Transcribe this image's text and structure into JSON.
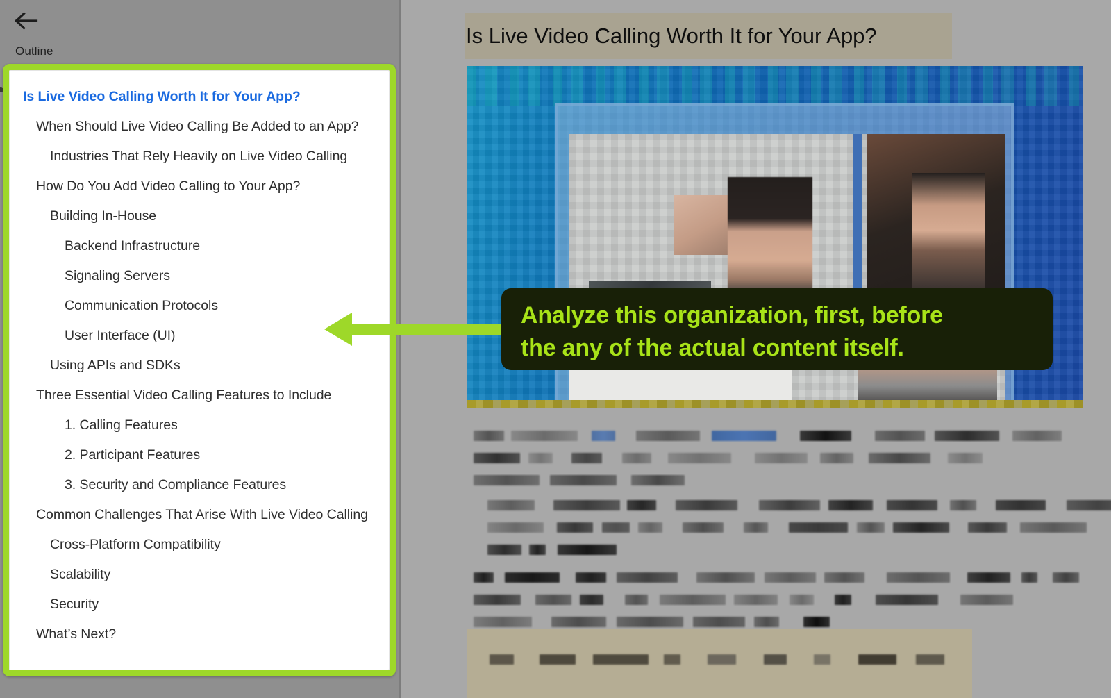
{
  "sidebar": {
    "back_icon": "back-arrow-icon",
    "label": "Outline",
    "outline_items": [
      {
        "text": "Is Live Video Calling Worth It for Your App?",
        "level": 0,
        "current": true
      },
      {
        "text": "When Should Live Video Calling Be Added to an App?",
        "level": 1,
        "current": false
      },
      {
        "text": "Industries That Rely Heavily on Live Video Calling",
        "level": 2,
        "current": false
      },
      {
        "text": "How Do You Add Video Calling to Your App?",
        "level": 1,
        "current": false
      },
      {
        "text": "Building In-House",
        "level": 2,
        "current": false
      },
      {
        "text": "Backend Infrastructure",
        "level": 3,
        "current": false
      },
      {
        "text": "Signaling Servers",
        "level": 3,
        "current": false
      },
      {
        "text": "Communication Protocols",
        "level": 3,
        "current": false
      },
      {
        "text": "User Interface (UI)",
        "level": 3,
        "current": false
      },
      {
        "text": "Using APIs and SDKs",
        "level": 2,
        "current": false
      },
      {
        "text": "Three Essential Video Calling Features to Include",
        "level": 1,
        "current": false
      },
      {
        "text": "1. Calling Features",
        "level": 3,
        "current": false
      },
      {
        "text": "2. Participant Features",
        "level": 3,
        "current": false
      },
      {
        "text": "3. Security and Compliance Features",
        "level": 3,
        "current": false
      },
      {
        "text": "Common Challenges That Arise With Live Video Calling",
        "level": 1,
        "current": false
      },
      {
        "text": "Cross-Platform Compatibility",
        "level": 2,
        "current": false
      },
      {
        "text": "Scalability",
        "level": 2,
        "current": false
      },
      {
        "text": "Security",
        "level": 2,
        "current": false
      },
      {
        "text": "What’s Next?",
        "level": 1,
        "current": false
      }
    ]
  },
  "content": {
    "article_title": "Is Live Video Calling Worth It for Your App?",
    "hero_image_alt": "video-call-screenshot",
    "body_state": "blurred"
  },
  "annotation": {
    "line1": "Analyze this organization, first, before",
    "line2": "the any of the actual content itself.",
    "arrow_direction": "left",
    "arrow_icon": "left-arrow-annotation-icon"
  },
  "colors": {
    "highlight_green": "#9ed829",
    "callout_bg": "#182007",
    "callout_text": "#a8e318",
    "current_item_blue": "#1a6ae0",
    "title_highlight": "#a9a391",
    "pane_gray": "#8f8f8f",
    "content_gray": "#a8a8a8"
  }
}
